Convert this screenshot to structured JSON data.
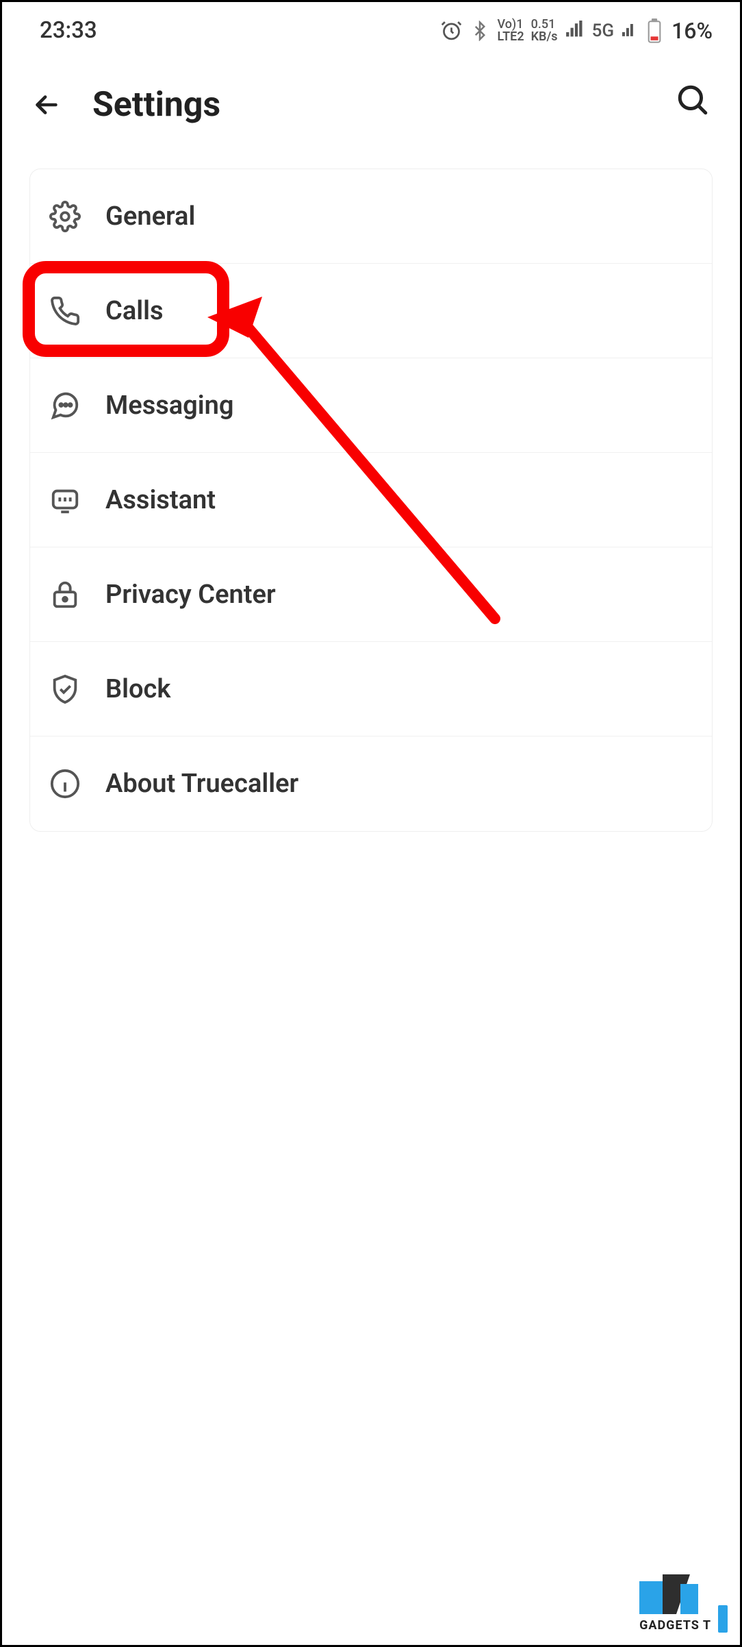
{
  "status": {
    "time": "23:33",
    "net_vo": "Vo)1",
    "net_lte": "LTE2",
    "net_speed_top": "0.51",
    "net_speed_bottom": "KB/s",
    "network_label": "5G",
    "battery_percent": "16%"
  },
  "appbar": {
    "title": "Settings"
  },
  "settings": {
    "items": [
      {
        "icon": "gear-icon",
        "label": "General"
      },
      {
        "icon": "phone-icon",
        "label": "Calls"
      },
      {
        "icon": "message-icon",
        "label": "Messaging"
      },
      {
        "icon": "assistant-icon",
        "label": "Assistant"
      },
      {
        "icon": "lock-icon",
        "label": "Privacy Center"
      },
      {
        "icon": "shield-icon",
        "label": "Block"
      },
      {
        "icon": "info-icon",
        "label": "About Truecaller"
      }
    ]
  },
  "annotation": {
    "highlight_target": "Calls",
    "color": "#f80000"
  },
  "watermark": {
    "text": "GADGETS T"
  }
}
